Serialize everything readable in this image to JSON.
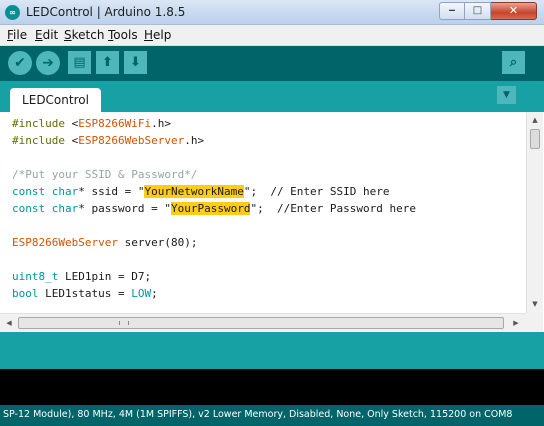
{
  "window": {
    "title": "LEDControl | Arduino 1.8.5",
    "app_icon": "arduino-icon",
    "minimize_glyph": "‒",
    "maximize_glyph": "□",
    "close_glyph": "✕"
  },
  "menu": {
    "items": [
      {
        "mnemonic": "F",
        "rest": "ile"
      },
      {
        "mnemonic": "E",
        "rest": "dit"
      },
      {
        "mnemonic": "S",
        "rest": "ketch"
      },
      {
        "mnemonic": "T",
        "rest": "ools"
      },
      {
        "mnemonic": "H",
        "rest": "elp"
      }
    ]
  },
  "toolbar": {
    "verify_icon": "✔",
    "upload_icon": "➔",
    "new_icon": "▤",
    "open_icon": "⬆",
    "save_icon": "⬇",
    "serial_monitor_icon": "⌕"
  },
  "tabs": {
    "active": "LEDControl",
    "menu_glyph": "▼"
  },
  "code": {
    "l1": {
      "kw": "#include",
      "open": " <",
      "lib": "ESP8266WiFi",
      "close": ".h>"
    },
    "l2": {
      "kw": "#include",
      "open": " <",
      "lib": "ESP8266WebServer",
      "close": ".h>"
    },
    "l4": {
      "comment": "/*Put your SSID & Password*/"
    },
    "l5": {
      "kw": "const",
      "type": " char",
      "mid": "* ssid = \"",
      "value": "YourNetworkName",
      "end": "\";  // Enter SSID here"
    },
    "l6": {
      "kw": "const",
      "type": " char",
      "mid": "* password = \"",
      "value": "YourPassword",
      "end": "\";  //Enter Password here"
    },
    "l8": {
      "lib": "ESP8266WebServer",
      "rest": " server(80);"
    },
    "l10": {
      "type": "uint8_t",
      "rest": " LED1pin = D7;"
    },
    "l11": {
      "type": "bool",
      "rest": " LED1status = ",
      "value": "LOW",
      "end": ";"
    }
  },
  "scrollbars": {
    "up": "▲",
    "down": "▼",
    "left": "◀",
    "right": "▶"
  },
  "status": {
    "board_info": "SP-12 Module), 80 MHz, 4M (1M SPIFFS), v2 Lower Memory, Disabled, None, Only Sketch, 115200 on COM8"
  },
  "colors": {
    "toolbar": "#006468",
    "tabstrip": "#17a1a5",
    "highlight": "#ffcc1a"
  }
}
